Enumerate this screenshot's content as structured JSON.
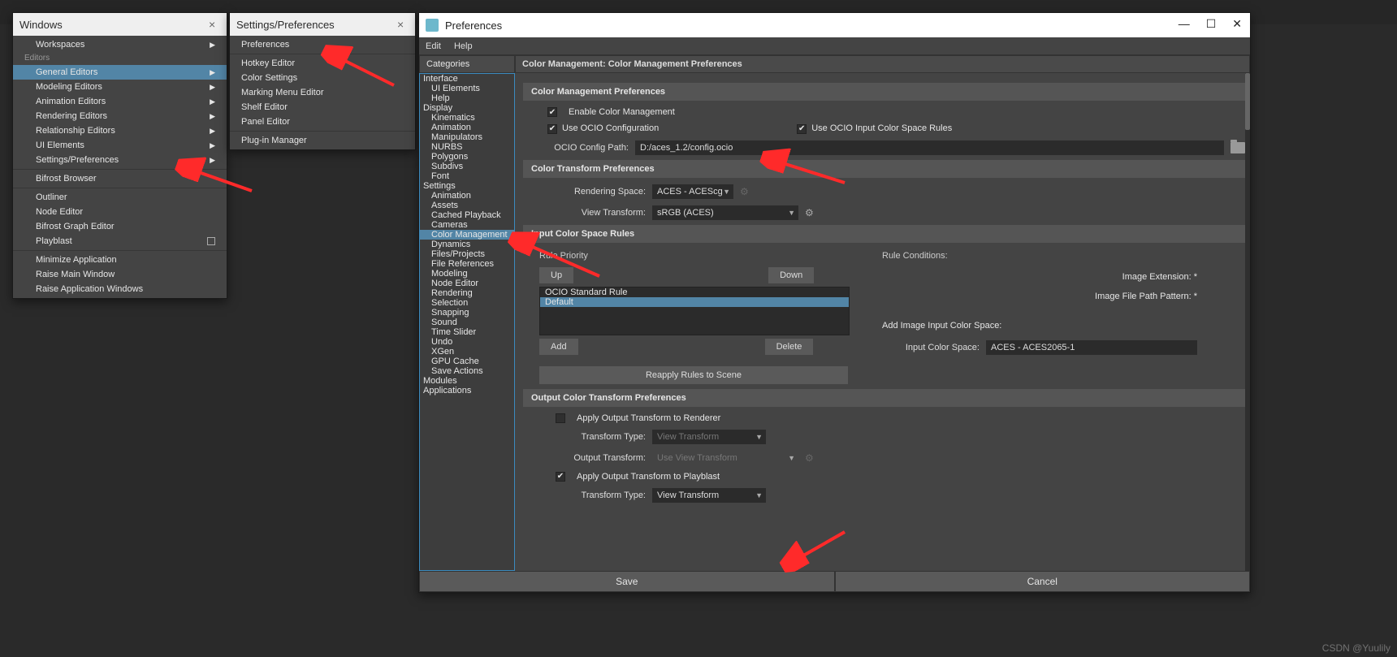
{
  "windows_menu": {
    "title": "Windows",
    "editors_label": "Editors",
    "items": {
      "workspaces": "Workspaces",
      "general_editors": "General Editors",
      "modeling_editors": "Modeling Editors",
      "animation_editors": "Animation Editors",
      "rendering_editors": "Rendering Editors",
      "relationship_editors": "Relationship Editors",
      "ui_elements": "UI Elements",
      "settings_prefs": "Settings/Preferences",
      "bifrost_browser": "Bifrost Browser",
      "outliner": "Outliner",
      "node_editor": "Node Editor",
      "bifrost_graph": "Bifrost Graph Editor",
      "playblast": "Playblast",
      "minimize": "Minimize Application",
      "raise_main": "Raise Main Window",
      "raise_all": "Raise Application Windows"
    }
  },
  "settings_menu": {
    "title": "Settings/Preferences",
    "items": [
      "Preferences",
      "Hotkey Editor",
      "Color Settings",
      "Marking Menu Editor",
      "Shelf Editor",
      "Panel Editor",
      "Plug-in Manager"
    ]
  },
  "prefs": {
    "title": "Preferences",
    "menu": [
      "Edit",
      "Help"
    ],
    "categories_label": "Categories",
    "main_header": "Color Management: Color Management Preferences",
    "categories": [
      {
        "t": "Interface",
        "lvl": 0
      },
      {
        "t": "UI Elements",
        "lvl": 1
      },
      {
        "t": "Help",
        "lvl": 1
      },
      {
        "t": "Display",
        "lvl": 0
      },
      {
        "t": "Kinematics",
        "lvl": 1
      },
      {
        "t": "Animation",
        "lvl": 1
      },
      {
        "t": "Manipulators",
        "lvl": 1
      },
      {
        "t": "NURBS",
        "lvl": 1
      },
      {
        "t": "Polygons",
        "lvl": 1
      },
      {
        "t": "Subdivs",
        "lvl": 1
      },
      {
        "t": "Font",
        "lvl": 1
      },
      {
        "t": "Settings",
        "lvl": 0
      },
      {
        "t": "Animation",
        "lvl": 1
      },
      {
        "t": "Assets",
        "lvl": 1
      },
      {
        "t": "Cached Playback",
        "lvl": 1
      },
      {
        "t": "Cameras",
        "lvl": 1
      },
      {
        "t": "Color Management",
        "lvl": 1,
        "sel": true
      },
      {
        "t": "Dynamics",
        "lvl": 1
      },
      {
        "t": "Files/Projects",
        "lvl": 1
      },
      {
        "t": "File References",
        "lvl": 1
      },
      {
        "t": "Modeling",
        "lvl": 1
      },
      {
        "t": "Node Editor",
        "lvl": 1
      },
      {
        "t": "Rendering",
        "lvl": 1
      },
      {
        "t": "Selection",
        "lvl": 1
      },
      {
        "t": "Snapping",
        "lvl": 1
      },
      {
        "t": "Sound",
        "lvl": 1
      },
      {
        "t": "Time Slider",
        "lvl": 1
      },
      {
        "t": "Undo",
        "lvl": 1
      },
      {
        "t": "XGen",
        "lvl": 1
      },
      {
        "t": "GPU Cache",
        "lvl": 1
      },
      {
        "t": "Save Actions",
        "lvl": 1
      },
      {
        "t": "Modules",
        "lvl": 0
      },
      {
        "t": "Applications",
        "lvl": 0
      }
    ],
    "sect_cm": "Color Management Preferences",
    "enable_cm": "Enable Color Management",
    "use_ocio": "Use OCIO Configuration",
    "use_rules": "Use OCIO Input Color Space Rules",
    "ocio_path_lbl": "OCIO Config Path:",
    "ocio_path": "D:/aces_1.2/config.ocio",
    "sect_ct": "Color Transform Preferences",
    "render_space_lbl": "Rendering Space:",
    "render_space": "ACES - ACEScg",
    "view_tf_lbl": "View Transform:",
    "view_tf": "sRGB (ACES)",
    "sect_rules": "Input Color Space Rules",
    "rule_priority": "Rule Priority",
    "rule_cond": "Rule Conditions:",
    "up": "Up",
    "down": "Down",
    "add": "Add",
    "delete": "Delete",
    "rules": [
      "OCIO Standard Rule",
      "Default"
    ],
    "img_ext": "Image Extension: *",
    "img_path": "Image File Path Pattern: *",
    "add_space_lbl": "Add Image Input Color Space:",
    "input_cs_lbl": "Input Color Space:",
    "input_cs": "ACES - ACES2065-1",
    "reapply": "Reapply Rules to Scene",
    "sect_out": "Output Color Transform Preferences",
    "apply_render": "Apply Output Transform to Renderer",
    "apply_pb": "Apply Output Transform to Playblast",
    "tf_type_lbl": "Transform Type:",
    "tf_type": "View Transform",
    "out_tf_lbl": "Output Transform:",
    "out_tf": "Use View Transform",
    "save": "Save",
    "cancel": "Cancel"
  },
  "watermark": "CSDN @Yuulily"
}
